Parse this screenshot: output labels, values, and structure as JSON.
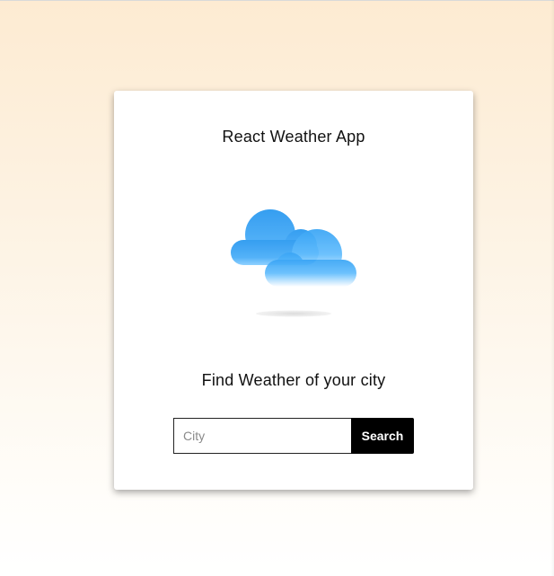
{
  "app": {
    "title": "React Weather App",
    "subtitle": "Find Weather of your city"
  },
  "weather_icon": {
    "name": "cloud-icon",
    "colors": {
      "cloud_top": "#2f9bf0",
      "cloud_mid": "#6cc0ff",
      "cloud_bottom": "#ffffff",
      "shadow": "#e6e6e6"
    }
  },
  "search": {
    "placeholder": "City",
    "value": "",
    "button_label": "Search"
  },
  "colors": {
    "background_top": "#fdebd2",
    "background_bottom": "#ffffff",
    "card": "#ffffff",
    "button": "#000000",
    "button_text": "#ffffff"
  }
}
